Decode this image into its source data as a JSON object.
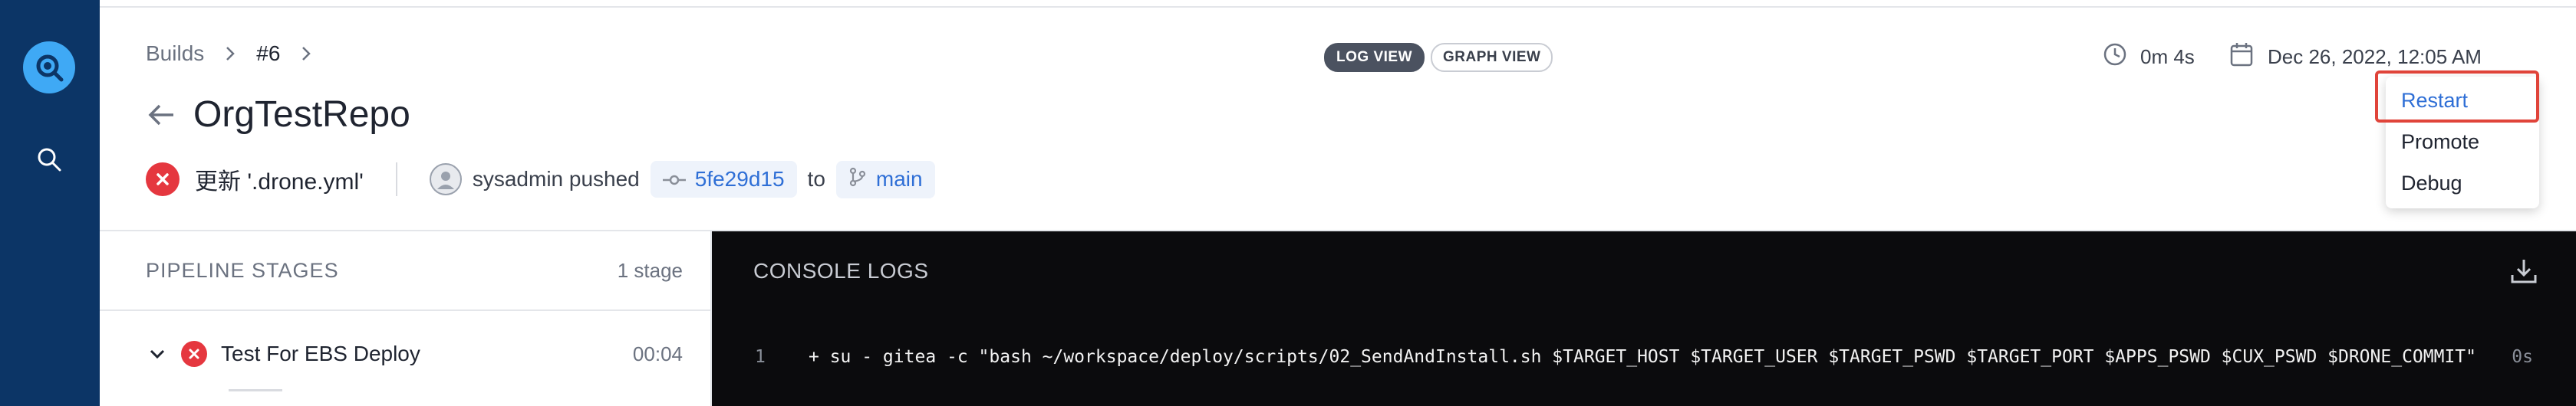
{
  "colors": {
    "nav_bg": "#0c3566",
    "logo": "#3fa9f5",
    "error": "#e5373f",
    "link": "#2f6fd6",
    "console_bg": "#0b0b0d",
    "highlight": "#e0443a"
  },
  "nav": {
    "logo_icon": "drone-logo-icon",
    "search_icon": "search-icon"
  },
  "breadcrumb": {
    "root": "Builds",
    "current": "#6"
  },
  "title": "OrgTestRepo",
  "commit": {
    "message": "更新 '.drone.yml'",
    "actor": "sysadmin pushed",
    "sha": "5fe29d15",
    "to": "to",
    "branch": "main"
  },
  "view_tabs": {
    "log": "LOG VIEW",
    "graph": "GRAPH VIEW"
  },
  "meta": {
    "duration": "0m 4s",
    "created": "Dec 26, 2022, 12:05 AM"
  },
  "menu": {
    "items": [
      "Restart",
      "Promote",
      "Debug"
    ]
  },
  "stages": {
    "heading": "PIPELINE STAGES",
    "count": "1 stage",
    "items": [
      {
        "name": "Test For EBS Deploy",
        "duration": "00:04"
      }
    ]
  },
  "console": {
    "heading": "CONSOLE LOGS",
    "lines": [
      {
        "number": "1",
        "text": "+ su - gitea -c \"bash ~/workspace/deploy/scripts/02_SendAndInstall.sh $TARGET_HOST $TARGET_USER $TARGET_PSWD $TARGET_PORT $APPS_PSWD $CUX_PSWD $DRONE_COMMIT\"",
        "time": "0s"
      }
    ]
  }
}
